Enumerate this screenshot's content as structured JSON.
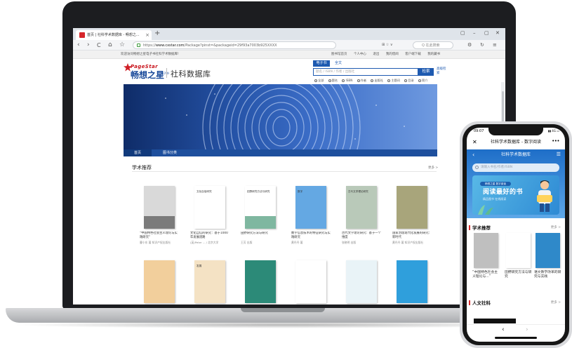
{
  "browser": {
    "tab_title": "首页 | 社科学术数据库 - 畅想之...",
    "tab_close": "×",
    "new_tab": "+",
    "window_controls": [
      "▢",
      "–",
      "▢",
      "✕"
    ],
    "nav": {
      "back": "‹",
      "forward": "›",
      "reload": "C",
      "home": "⌂",
      "star": "☆"
    },
    "url_prefix": "https://",
    "url_host": "www.cxstar.com",
    "url_path": "/Package?pinst=&packageid=29f93a7003b925XXXX",
    "url_icons": "⊞ ☆ ∨",
    "search_placeholder": "Q 在此搜索",
    "right_icons": [
      "⚙",
      "↻",
      "≡"
    ]
  },
  "site": {
    "welcome": "欢迎访问畅想之星电子书社科学术数据库!",
    "top_links": [
      "图书馆首页",
      "个人中心",
      "退出",
      "我的借阅",
      "客户端下载",
      "我的藏书"
    ],
    "logo_en": "PageStar",
    "logo_cn": "畅想之星",
    "logo_tm": "电子书",
    "site_name": "社科数据库",
    "search_tabs": [
      "电子书",
      "全文"
    ],
    "search_placeholder": "题名 / ISBN / 作者 / 出版社",
    "search_button": "检索",
    "advanced_search": "高级检索",
    "search_scopes": [
      "全部",
      "题名",
      "ISBN",
      "作者",
      "出版社",
      "主题词",
      "目录",
      "简介"
    ],
    "nav_items": [
      "首页",
      "图书分类"
    ],
    "section_title": "学术推荐",
    "more_label": "更多 >",
    "books": [
      {
        "caption": "“中国特色社会主义理论与实践研究”",
        "author": "曹小东 著  知识产权出版社",
        "cover": "#d9d9d9",
        "band": "#7b7b7b",
        "title": ""
      },
      {
        "caption": "文化自信的研究：基于1000年发展道路",
        "author": "(英)Peter  ... / 北京大学",
        "cover": "#ffffff",
        "band": "",
        "title": "文化自信研究"
      },
      {
        "caption": "田野研究方法与研究",
        "author": "王芳 出版",
        "cover": "#ffffff",
        "band": "#7fb7a0",
        "title": "田野研究方法与研究"
      },
      {
        "caption": "数字信息技术的特征研究与实践研究",
        "author": "黄丹丹 著",
        "cover": "#64a8e3",
        "band": "",
        "title": "数字"
      },
      {
        "caption": "古代文学理论研究：基于一个维度",
        "author": "张晓明 出版",
        "cover": "#b9c9b9",
        "band": "",
        "title": "古代文学理论研究"
      },
      {
        "caption": "国家治理现代化发展的研究：新时代",
        "author": "黄丹丹 著 知识产权出版社",
        "cover": "#a8a57b",
        "band": "",
        "title": ""
      },
      {
        "caption": "",
        "author": "",
        "cover": "#f2cf9c",
        "band": "",
        "title": ""
      },
      {
        "caption": "",
        "author": "",
        "cover": "#f4e2c4",
        "band": "",
        "title": "发展"
      },
      {
        "caption": "",
        "author": "",
        "cover": "#2c8a78",
        "band": "",
        "title": ""
      },
      {
        "caption": "",
        "author": "",
        "cover": "#ffffff",
        "band": "",
        "title": ""
      },
      {
        "caption": "",
        "author": "",
        "cover": "#e9f3f7",
        "band": "",
        "title": ""
      },
      {
        "caption": "",
        "author": "",
        "cover": "#2f9fdc",
        "band": "",
        "title": ""
      }
    ]
  },
  "phone": {
    "time": "09:07",
    "signal": "▮▮ 4G ▭",
    "app_title": "社科学术数据库 - 数字阅读",
    "close": "✕",
    "dots": "•••",
    "nav_title": "社科学术数据库",
    "back": "‹",
    "menu": "☰",
    "search_placeholder": "请输入书名/作者/ISBN",
    "banner_pill": "畅想之星 数字阅读",
    "banner_title": "阅读最好的书",
    "banner_sub": "精品图书 在线阅读",
    "section1": "学术推荐",
    "section2": "人文社科",
    "more": "更多 >",
    "books": [
      {
        "caption": "“中国特色社会主义理论与...”",
        "cover": "#bfbfbf"
      },
      {
        "caption": "田野研究方法与研究",
        "cover": "#ffffff"
      },
      {
        "caption": "语文教学改革的研究与实践",
        "cover": "#2f89c9"
      }
    ],
    "bottom_back": "‹",
    "bottom_forward": "›"
  },
  "colors": {
    "brand_blue": "#1e5ab0",
    "brand_red": "#c8141c",
    "laptop_bezel": "#1c1d20"
  }
}
